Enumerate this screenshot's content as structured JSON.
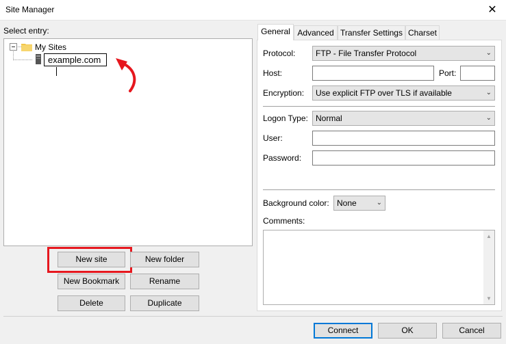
{
  "window": {
    "title": "Site Manager",
    "close_glyph": "✕"
  },
  "left": {
    "select_entry_label": "Select entry:",
    "tree": {
      "expander": "⊟",
      "root_label": "My Sites",
      "child_edit_value": "example.com"
    },
    "buttons": {
      "new_site": "New site",
      "new_folder": "New folder",
      "new_bookmark": "New Bookmark",
      "rename": "Rename",
      "delete": "Delete",
      "duplicate": "Duplicate"
    }
  },
  "tabs": [
    "General",
    "Advanced",
    "Transfer Settings",
    "Charset"
  ],
  "general": {
    "protocol_label": "Protocol:",
    "protocol_value": "FTP - File Transfer Protocol",
    "host_label": "Host:",
    "host_value": "",
    "port_label": "Port:",
    "port_value": "",
    "encryption_label": "Encryption:",
    "encryption_value": "Use explicit FTP over TLS if available",
    "logon_type_label": "Logon Type:",
    "logon_type_value": "Normal",
    "user_label": "User:",
    "user_value": "",
    "password_label": "Password:",
    "password_value": "",
    "background_color_label": "Background color:",
    "background_color_value": "None",
    "comments_label": "Comments:"
  },
  "footer": {
    "connect": "Connect",
    "ok": "OK",
    "cancel": "Cancel"
  },
  "colors": {
    "highlight_red": "#e6171e",
    "folder_yellow": "#f3c64a",
    "focus_blue": "#0078d7"
  }
}
